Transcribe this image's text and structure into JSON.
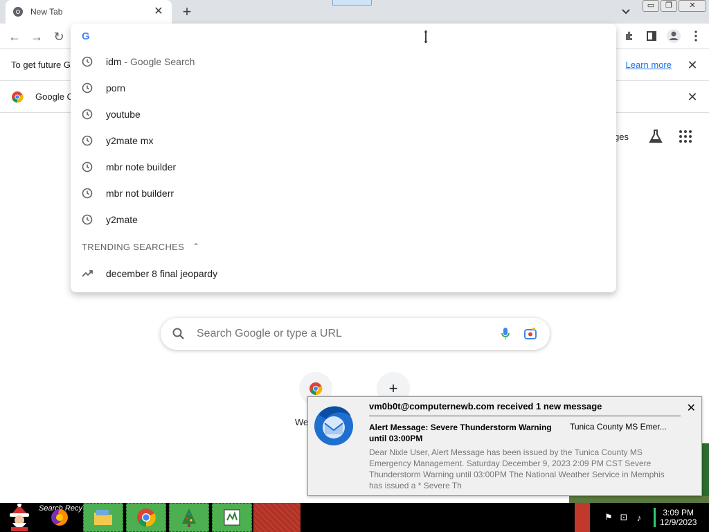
{
  "browser": {
    "tab_title": "New Tab",
    "tab_close": "✕",
    "new_tab": "+",
    "window_buttons": [
      "▭",
      "❐",
      "✕"
    ]
  },
  "infobars": {
    "first_message": "To get future G",
    "learn_more": "Learn more",
    "second_message": "Google C"
  },
  "omnibox": {
    "google_glyph": "G",
    "suggestions": [
      {
        "text": "idm",
        "sub": " - Google Search"
      },
      {
        "text": "porn",
        "sub": ""
      },
      {
        "text": "youtube",
        "sub": ""
      },
      {
        "text": "y2mate mx",
        "sub": ""
      },
      {
        "text": "mbr note builder",
        "sub": ""
      },
      {
        "text": "mbr not builderr",
        "sub": ""
      },
      {
        "text": "y2mate",
        "sub": ""
      }
    ],
    "trending_header": "TRENDING SEARCHES",
    "trending": [
      {
        "text": "december 8 final jeopardy"
      }
    ]
  },
  "ntp": {
    "images_text": "ges",
    "search_placeholder": "Search Google or type a URL",
    "shortcut_label": "We",
    "add_shortcut": "+"
  },
  "notification": {
    "header": "vm0b0t@computernewb.com received 1 new message",
    "subject": "Alert Message: Severe Thunderstorm Warning until 03:00PM",
    "sender": "Tunica County MS Emer...",
    "preview": "Dear Nixle User, Alert Message has been issued by the Tunica County MS Emergency Management. Saturday December 9, 2023 2:09 PM CST Severe Thunderstorm Warning until 03:00PM The National Weather Service in Memphis has issued a * Severe Th",
    "close": "✕"
  },
  "taskbar": {
    "label": "Search Recy",
    "clock_time": "3:09 PM",
    "clock_date": "12/9/2023"
  },
  "colors": {
    "accent": "#1a73e8",
    "chrome_frame": "#dee1e6",
    "taskbar_green": "#4caf50",
    "taskbar_red": "#c0392b"
  }
}
